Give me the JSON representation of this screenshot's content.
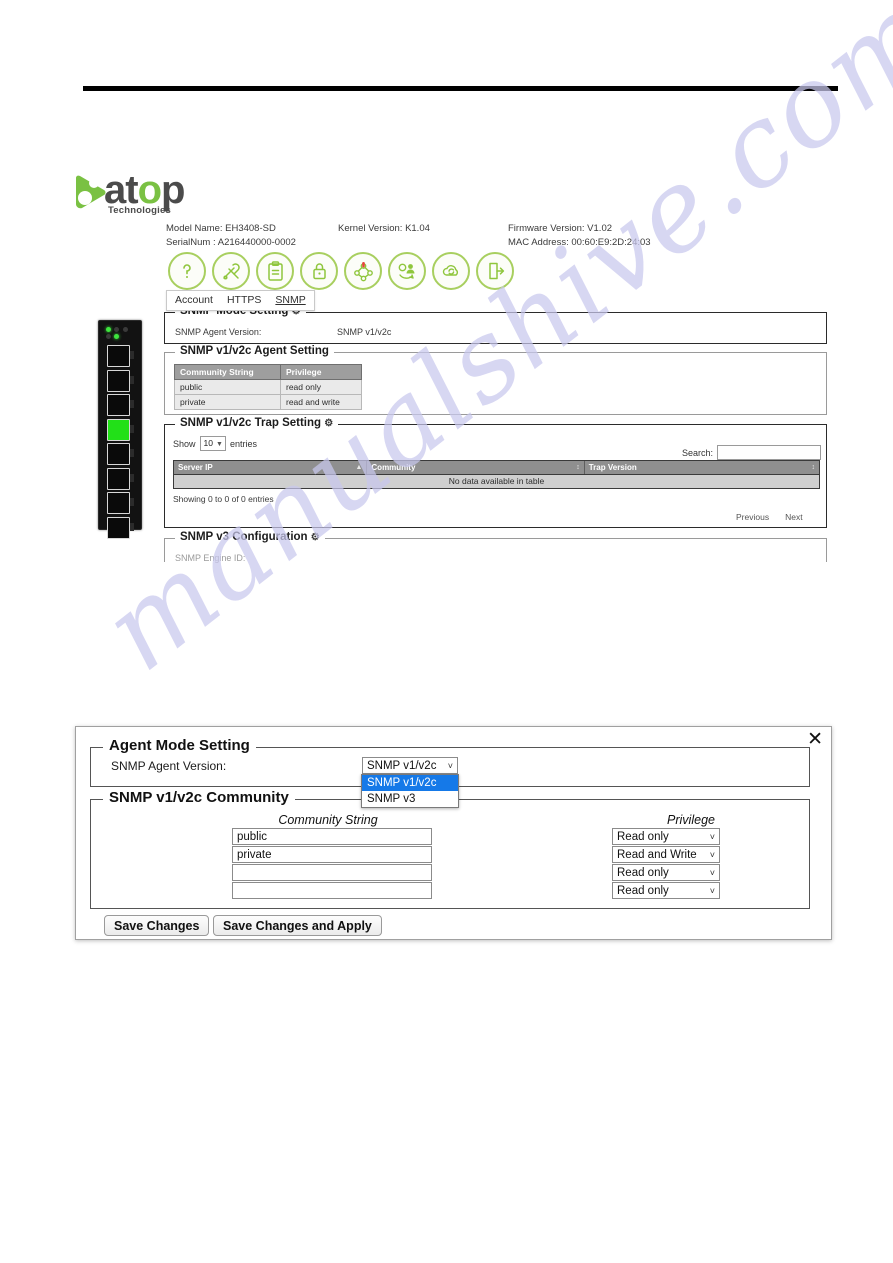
{
  "brand": {
    "name": "atop",
    "tagline": "Technologies",
    "green": "#7ac143"
  },
  "device_info": {
    "model_label": "Model Name: EH3408-SD",
    "serial_label": "SerialNum : A216440000-0002",
    "kernel_label": "Kernel Version: K1.04",
    "firmware_label": "Firmware Version: V1.02",
    "mac_label": "MAC Address: 00:60:E9:2D:24:03"
  },
  "nav_icons": [
    {
      "name": "help-icon"
    },
    {
      "name": "tools-icon"
    },
    {
      "name": "clipboard-icon"
    },
    {
      "name": "lock-icon"
    },
    {
      "name": "network-alert-icon"
    },
    {
      "name": "user-settings-icon"
    },
    {
      "name": "cloud-sync-icon"
    },
    {
      "name": "logout-icon"
    }
  ],
  "tabs": [
    {
      "label": "Account",
      "active": false
    },
    {
      "label": "HTTPS",
      "active": false
    },
    {
      "label": "SNMP",
      "active": true
    }
  ],
  "mode_panel": {
    "title": "SNMP Mode Setting",
    "gear": "⚙",
    "agent_version_label": "SNMP Agent Version:",
    "agent_version_value": "SNMP v1/v2c"
  },
  "agent_panel": {
    "title": "SNMP v1/v2c Agent Setting",
    "columns": [
      "Community String",
      "Privilege"
    ],
    "rows": [
      [
        "public",
        "read only"
      ],
      [
        "private",
        "read and write"
      ]
    ]
  },
  "trap_panel": {
    "title": "SNMP v1/v2c Trap Setting",
    "gear": "⚙",
    "show_prefix": "Show",
    "show_value": "10",
    "show_suffix": "entries",
    "search_label": "Search:",
    "search_value": "",
    "columns": [
      "Server IP",
      "Community",
      "Trap Version"
    ],
    "empty_text": "No data available in table",
    "info_text": "Showing 0 to 0 of 0 entries",
    "previous_label": "Previous",
    "next_label": "Next"
  },
  "v3_panel": {
    "title": "SNMP v3 Configuration",
    "gear": "⚙",
    "engine_id_label": "SNMP Engine ID:"
  },
  "dialog": {
    "close_label": "✕",
    "agent_mode": {
      "title": "Agent Mode Setting",
      "version_label": "SNMP Agent Version:",
      "version_selected": "SNMP v1/v2c",
      "options": [
        "SNMP v1/v2c",
        "SNMP v3"
      ],
      "highlighted_option": "SNMP v1/v2c",
      "highlight_color": "#1579e8"
    },
    "community": {
      "title": "SNMP v1/v2c Community",
      "col_community": "Community String",
      "col_privilege": "Privilege",
      "rows": [
        {
          "community": "public",
          "privilege": "Read only"
        },
        {
          "community": "private",
          "privilege": "Read and Write"
        },
        {
          "community": "",
          "privilege": "Read only"
        },
        {
          "community": "",
          "privilege": "Read only"
        }
      ]
    },
    "buttons": {
      "save": "Save Changes",
      "save_apply": "Save Changes and Apply"
    }
  },
  "watermark": {
    "text": "manualshive.com",
    "color": "#c9c8ee"
  }
}
